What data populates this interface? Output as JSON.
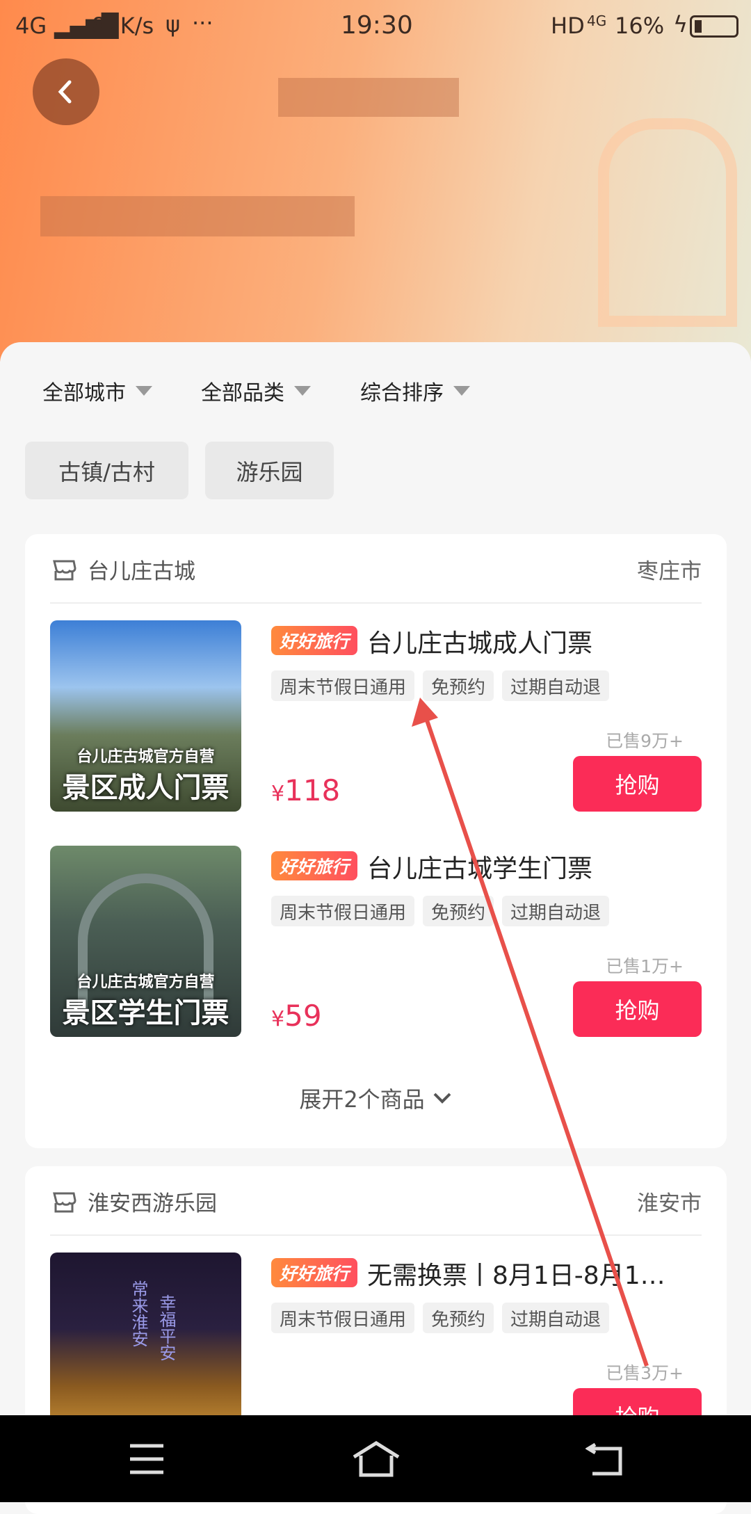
{
  "status_bar": {
    "network": "4G",
    "speed": "87K/s",
    "dots": "···",
    "time": "19:30",
    "hd": "HD",
    "net2": "4G",
    "battery": "16%"
  },
  "filters": [
    {
      "label": "全部城市"
    },
    {
      "label": "全部品类"
    },
    {
      "label": "综合排序"
    }
  ],
  "chips": [
    {
      "label": "古镇/古村"
    },
    {
      "label": "游乐园"
    }
  ],
  "badge_label": "好好旅行",
  "cards": [
    {
      "store": "台儿庄古城",
      "city": "枣庄市",
      "expand": "展开2个商品",
      "items": [
        {
          "title": "台儿庄古城成人门票",
          "tags": [
            "周末节假日通用",
            "免预约",
            "过期自动退"
          ],
          "sold": "已售9万+",
          "currency": "¥",
          "price": "118",
          "buy": "抢购",
          "img_line1": "台儿庄古城官方自营",
          "img_line2": "景区成人门票"
        },
        {
          "title": "台儿庄古城学生门票",
          "tags": [
            "周末节假日通用",
            "免预约",
            "过期自动退"
          ],
          "sold": "已售1万+",
          "currency": "¥",
          "price": "59",
          "buy": "抢购",
          "img_line1": "台儿庄古城官方自营",
          "img_line2": "景区学生门票"
        }
      ]
    },
    {
      "store": "淮安西游乐园",
      "city": "淮安市",
      "items": [
        {
          "title": "无需换票丨8月1日-8月1…",
          "tags": [
            "周末节假日通用",
            "免预约",
            "过期自动退"
          ],
          "sold": "已售3万+",
          "buy": "抢购",
          "img_line1": "常来淮安",
          "img_line2": "幸福平安"
        }
      ]
    }
  ],
  "colors": {
    "accent": "#fb2c57",
    "price": "#e8315a",
    "header_start": "#ff8a4c",
    "arrow": "#e8504a"
  }
}
